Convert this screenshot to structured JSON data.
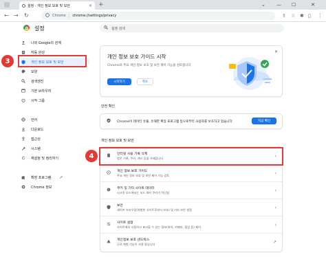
{
  "tab": {
    "title": "설정 - 개인 정보 보호 및 보안",
    "close": "×",
    "new_tab": "+"
  },
  "window": {
    "collapse": "⌄",
    "minimize": "—",
    "maximize": "☐",
    "close": "✕"
  },
  "toolbar": {
    "back": "←",
    "forward": "→",
    "reload": "↻",
    "site_chip": "Chrome",
    "url": "chrome://settings/privacy"
  },
  "sidebar": {
    "title": "설정",
    "items": [
      {
        "label": "나와 Google의 관계",
        "icon": "person-icon"
      },
      {
        "label": "자동 완성",
        "icon": "clipboard-icon"
      },
      {
        "label": "개인 정보 보호 및 보안",
        "icon": "shield-icon",
        "active": true
      },
      {
        "label": "모양",
        "icon": "palette-icon"
      },
      {
        "label": "검색엔진",
        "icon": "search-icon"
      },
      {
        "label": "기본 브라우저",
        "icon": "browser-icon"
      },
      {
        "label": "시작 그룹",
        "icon": "power-icon"
      },
      {
        "label": "언어",
        "icon": "globe-icon"
      },
      {
        "label": "다운로드",
        "icon": "download-icon"
      },
      {
        "label": "접근성",
        "icon": "accessibility-icon"
      },
      {
        "label": "시스템",
        "icon": "wrench-icon"
      },
      {
        "label": "재설정 및 정리하기",
        "icon": "reset-icon"
      },
      {
        "label": "확장 프로그램",
        "icon": "puzzle-icon"
      },
      {
        "label": "Chrome 정보",
        "icon": "chrome-icon"
      }
    ]
  },
  "annotations": {
    "sidebar_marker": "3",
    "row_marker": "4",
    "highlight_color": "#e53935"
  },
  "search": {
    "placeholder": "설정 검색"
  },
  "promo": {
    "title": "개인 정보 보호 가이드 시작",
    "desc": "Chrome의 주요 개인 정보 보호 및 보안 제어 기능을 검토합니다",
    "start_label": "시작하기",
    "cancel_label": "취소"
  },
  "safety": {
    "section_title": "안전 확인",
    "text": "Chrome이 데이터 유출, 유해한 확장 프로그램 등으로부터 사용자를 보호하고 있습니다",
    "button_label": "지금 확인"
  },
  "privacy": {
    "section_title": "개인 정보 보호 및 보안",
    "rows": [
      {
        "title": "인터넷 사용 기록 삭제",
        "sub": "방문 기록, 쿠키, 캐시 등을 삭제합니다.",
        "icon": "trash-icon",
        "trailing": "›"
      },
      {
        "title": "개인 정보 보호 가이드",
        "sub": "주요 개인 정보 보호 및 보안 제어 기능 검토",
        "icon": "privacy-guide-icon",
        "trailing": "›"
      },
      {
        "title": "쿠키 및 기타 사이트 데이터",
        "sub": "시크릿 모드에서는 서드 파티 쿠키가 차단됨",
        "icon": "cookie-icon",
        "trailing": "›"
      },
      {
        "title": "보안",
        "sub": "세이프 브라우징(위험한 사이트로부터 보호) 및 기타 보안 설정",
        "icon": "security-icon",
        "trailing": "›"
      },
      {
        "title": "사이트 설정",
        "sub": "사이트에서 사용하고 표시할 수 있는 정보(위치, 카메라, 팝업 등) 제어",
        "icon": "sliders-icon",
        "trailing": "›"
      },
      {
        "title": "개인정보 보호 샌드박스",
        "sub": "무료 체험 기능이 사용 중입니다",
        "icon": "sandbox-icon",
        "trailing": "↗"
      }
    ]
  },
  "colors": {
    "accent": "#1a73e8",
    "annotation": "#e53935"
  }
}
